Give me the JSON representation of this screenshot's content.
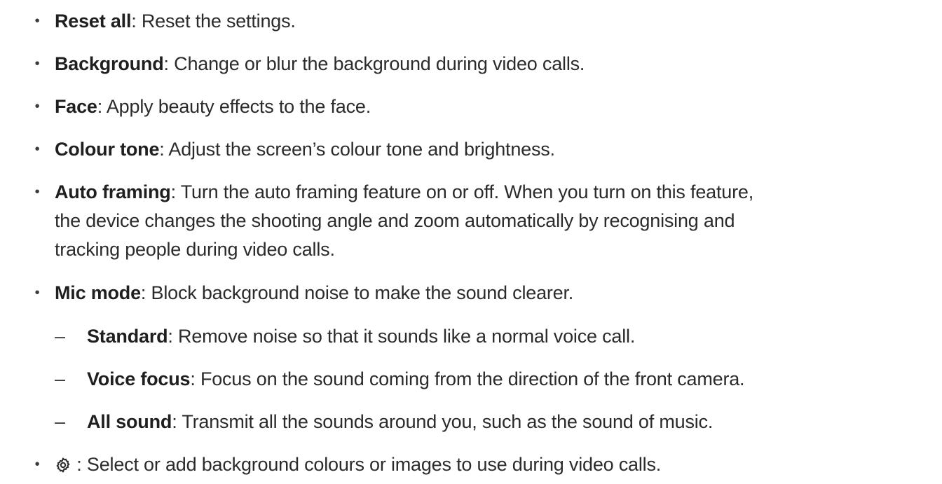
{
  "items": [
    {
      "term": "Reset all",
      "sep": ": ",
      "desc": "Reset the settings."
    },
    {
      "term": "Background",
      "sep": ": ",
      "desc": "Change or blur the background during video calls."
    },
    {
      "term": "Face",
      "sep": ": ",
      "desc": "Apply beauty effects to the face."
    },
    {
      "term": "Colour tone",
      "sep": ": ",
      "desc": "Adjust the screen’s colour tone and brightness."
    },
    {
      "term": "Auto framing",
      "sep": ": ",
      "desc": "Turn the auto framing feature on or off. When you turn on this feature,",
      "desc2": "the device changes the shooting angle and zoom automatically by recognising and",
      "desc3": "tracking people during video calls."
    },
    {
      "term": "Mic mode",
      "sep": ": ",
      "desc": "Block background noise to make the sound clearer."
    }
  ],
  "sub_items": [
    {
      "term": "Standard",
      "sep": ": ",
      "desc": "Remove noise so that it sounds like a normal voice call."
    },
    {
      "term": "Voice focus",
      "sep": ": ",
      "desc": "Focus on the sound coming from the direction of the front camera."
    },
    {
      "term": "All sound",
      "sep": ": ",
      "desc": "Transmit all the sounds around you, such as the sound of music."
    }
  ],
  "gear_item": {
    "icon": "gear-icon",
    "sep": " : ",
    "desc": "Select or add background colours or images to use during video calls."
  },
  "bullet_char": "•",
  "dash_char": "–"
}
